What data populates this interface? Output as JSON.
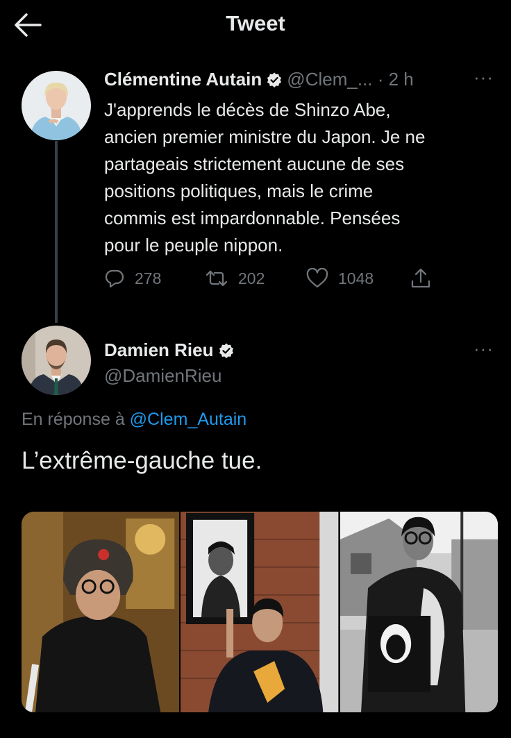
{
  "header": {
    "title": "Tweet"
  },
  "tweet1": {
    "author_name": "Clémentine Autain",
    "handle": "@Clem_...",
    "time": "· 2 h",
    "more": "···",
    "text": "J'apprends le décès de Shinzo Abe,\nancien premier ministre du Japon. Je ne\npartageais strictement aucune de ses\npositions politiques, mais le crime\ncommis est impardonnable. Pensées\npour le peuple nippon.",
    "replies": "278",
    "retweets": "202",
    "likes": "1048"
  },
  "tweet2": {
    "author_name": "Damien Rieu",
    "handle": "@DamienRieu",
    "more": "···",
    "reply_prefix": "En réponse à",
    "reply_to": "@Clem_Autain",
    "text": "L’extrême-gauche tue."
  },
  "colors": {
    "background": "#000000",
    "text": "#e7e9ea",
    "muted": "#71767b",
    "link": "#1d9bf0",
    "verified": "#e7e9ea"
  },
  "icons": [
    "back-arrow-icon",
    "verified-icon",
    "more-icon",
    "reply-icon",
    "retweet-icon",
    "like-icon",
    "share-icon"
  ]
}
